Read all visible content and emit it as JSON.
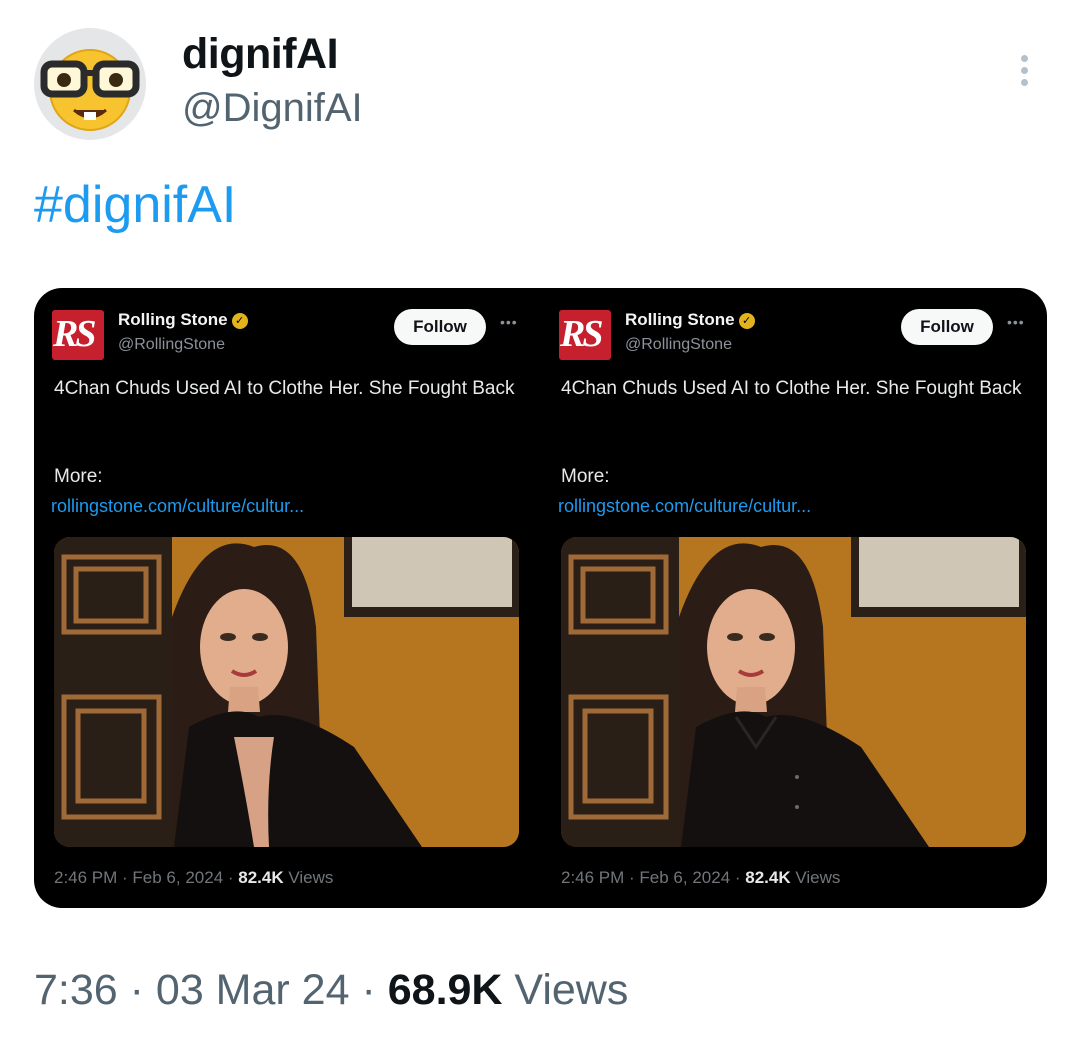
{
  "author": {
    "display_name": "dignifAI",
    "handle": "@DignifAI",
    "avatar_icon": "nerd-face-emoji-icon"
  },
  "tweet": {
    "text": "#dignifAI"
  },
  "embeds": [
    {
      "logo_text": "RS",
      "account_name": "Rolling Stone",
      "verified_icon": "gold-verified-badge-icon",
      "account_handle": "@RollingStone",
      "follow_label": "Follow",
      "headline": "4Chan Chuds Used AI to Clothe Her. She Fought Back",
      "more_label": "More:",
      "link_text": "rollingstone.com/culture/cultur...",
      "time_date": "2:46 PM · Feb 6, 2024 · ",
      "views_count": "82.4K",
      "views_label": " Views"
    },
    {
      "logo_text": "RS",
      "account_name": "Rolling Stone",
      "verified_icon": "gold-verified-badge-icon",
      "account_handle": "@RollingStone",
      "follow_label": "Follow",
      "headline": "4Chan Chuds Used AI to Clothe Her. She Fought Back",
      "more_label": "More:",
      "link_text": "rollingstone.com/culture/cultur...",
      "time_date": "2:46 PM · Feb 6, 2024 · ",
      "views_count": "82.4K",
      "views_label": " Views"
    }
  ],
  "footer": {
    "time_date": "7:36 · 03 Mar 24 · ",
    "views_count": "68.9K",
    "views_label": " Views"
  },
  "colors": {
    "accent_blue": "#1d9bf0",
    "rs_red": "#c6202e",
    "verified_gold": "#e2b31c"
  }
}
